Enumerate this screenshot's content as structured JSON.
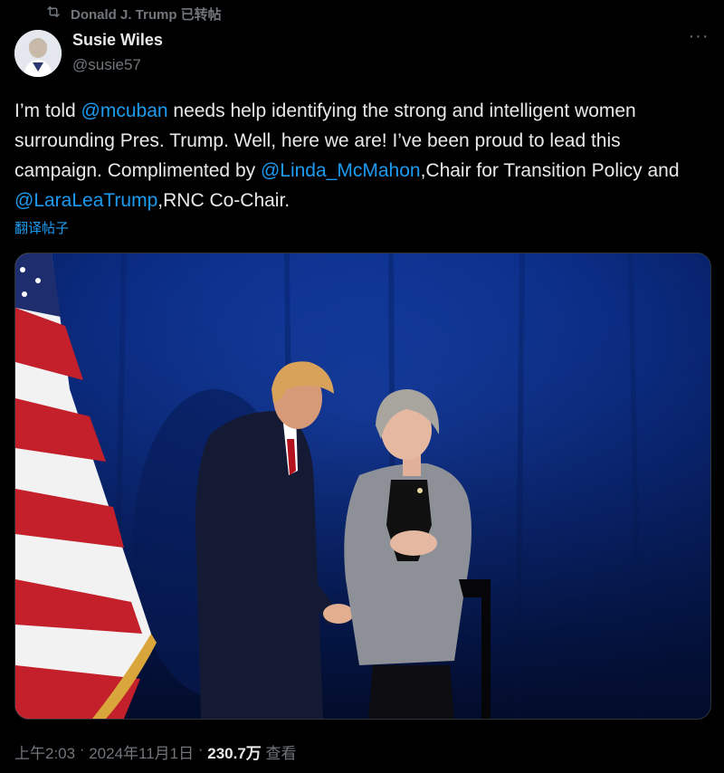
{
  "repost": {
    "label": "Donald J. Trump 已转帖"
  },
  "author": {
    "name": "Susie Wiles",
    "handle": "@susie57"
  },
  "more_label": "···",
  "tweet": {
    "segments": [
      "I’m told ",
      "@mcuban",
      " needs help identifying the strong and intelligent women surrounding Pres. Trump. Well, here we are! I’ve been proud to lead this campaign. Complimented by ",
      "@Linda_McMahon",
      ",Chair for Transition Policy and ",
      "@LaraLeaTrump",
      ",RNC Co-Chair."
    ]
  },
  "translate_label": "翻译帖子",
  "meta": {
    "time": "上午2:03",
    "sep1": " · ",
    "date": "2024年11月1日",
    "sep2": " · ",
    "views_count": "230.7万",
    "views_label": " 查看"
  },
  "colors": {
    "accent": "#1d9bf0",
    "muted": "#71767b",
    "text": "#e7e9ea",
    "background": "#000000"
  },
  "icons": {
    "repost": "repost-icon",
    "more": "more-icon"
  }
}
